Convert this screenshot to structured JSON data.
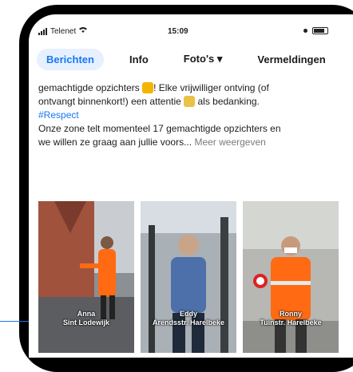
{
  "status_bar": {
    "carrier": "Telenet",
    "time": "15:09"
  },
  "tabs": [
    {
      "label": "Berichten"
    },
    {
      "label": "Info"
    },
    {
      "label": "Foto's ▾"
    },
    {
      "label": "Vermeldingen"
    }
  ],
  "post": {
    "line1_a": "gemachtigde opzichters",
    "line1_b": "! Elke vrijwilliger ontving (of",
    "line2_a": "ontvangt binnenkort!) een attentie",
    "line2_b": "als bedanking.",
    "hashtag": "#Respect",
    "line4": "Onze zone telt momenteel 17 gemachtigde opzichters en",
    "line5": "we willen ze graag aan jullie voors...",
    "more": "Meer weergeven"
  },
  "photos": [
    {
      "name": "Anna",
      "place": "Sint Lodewijk"
    },
    {
      "name": "Eddy",
      "place": "Arendsstr. Harelbeke"
    },
    {
      "name": "Ronny",
      "place": "Tuinstr. Harelbeke"
    }
  ],
  "colors": {
    "accent": "#1877f2",
    "vest": "#ff6a13"
  }
}
